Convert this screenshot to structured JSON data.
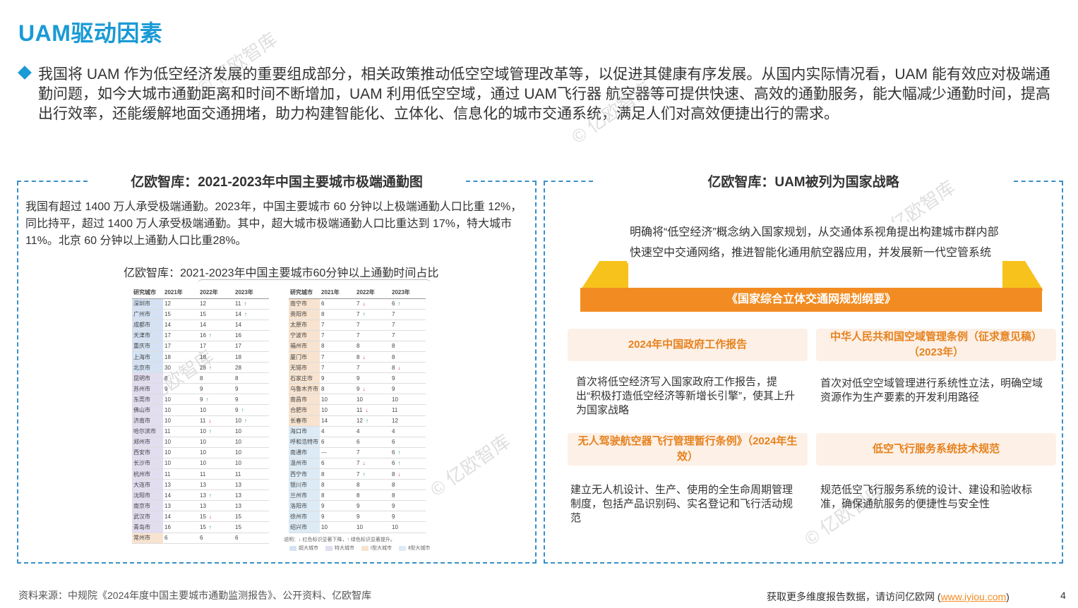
{
  "page": {
    "title": "UAM驱动因素",
    "intro": "我国将 UAM 作为低空经济发展的重要组成部分，相关政策推动低空空域管理改革等，以促进其健康有序发展。从国内实际情况看，UAM 能有效应对极端通勤问题，如今大城市通勤距离和时间不断增加，UAM 利用低空空域，通过 UAM飞行器 航空器等可提供快速、高效的通勤服务，能大幅减少通勤时间，提高出行效率，还能缓解地面交通拥堵，助力构建智能化、立体化、信息化的城市交通系统，满足人们对高效便捷出行的需求。",
    "watermark": "© 亿欧智库",
    "page_number": "4"
  },
  "left_panel": {
    "heading": "亿欧智库：2021-2023年中国主要城市极端通勤图",
    "paragraph": "我国有超过 1400 万人承受极端通勤。2023年，中国主要城市 60 分钟以上极端通勤人口比重 12%，同比持平，超过 1400 万人承受极端通勤。其中，超大城市极端通勤人口比重达到 17%，特大城市 11%。北京 60 分钟以上通勤人口比重28%。",
    "table_title": "亿欧智库：2021-2023年中国主要城市60分钟以上通勤时间占比",
    "legend_note": "说明：↓ 红色标识显著下降，↑ 绿色标识显著提升。",
    "legend_types": [
      "超大城市",
      "特大城市",
      "Ⅰ型大城市",
      "Ⅱ型大城市"
    ]
  },
  "chart_data": {
    "type": "table",
    "columns": [
      "研究城市",
      "2021年",
      "2022年",
      "2023年"
    ],
    "tables": [
      {
        "rows": [
          {
            "city": "深圳市",
            "tier": "super",
            "v2021": "12",
            "v2022": "12",
            "v2023": "11",
            "t2023": "up"
          },
          {
            "city": "广州市",
            "tier": "super",
            "v2021": "15",
            "v2022": "15",
            "v2023": "14",
            "t2023": "up"
          },
          {
            "city": "成都市",
            "tier": "super",
            "v2021": "14",
            "v2022": "14",
            "v2023": "14"
          },
          {
            "city": "天津市",
            "tier": "super",
            "v2021": "17",
            "v2022": "16",
            "t2022": "up",
            "v2023": "16"
          },
          {
            "city": "重庆市",
            "tier": "super",
            "v2021": "17",
            "v2022": "17",
            "v2023": "17"
          },
          {
            "city": "上海市",
            "tier": "super",
            "v2021": "18",
            "v2022": "18",
            "v2023": "18"
          },
          {
            "city": "北京市",
            "tier": "super",
            "v2021": "30",
            "v2022": "28",
            "t2022": "up",
            "v2023": "28"
          },
          {
            "city": "昆明市",
            "tier": "extra",
            "v2021": "8",
            "v2022": "8",
            "v2023": "8"
          },
          {
            "city": "苏州市",
            "tier": "extra",
            "v2021": "9",
            "v2022": "9",
            "v2023": "9"
          },
          {
            "city": "东莞市",
            "tier": "extra",
            "v2021": "10",
            "v2022": "9",
            "t2022": "up",
            "v2023": "9"
          },
          {
            "city": "佛山市",
            "tier": "extra",
            "v2021": "10",
            "v2022": "10",
            "v2023": "9",
            "t2023": "up"
          },
          {
            "city": "济南市",
            "tier": "extra",
            "v2021": "10",
            "v2022": "11",
            "t2022": "down",
            "v2023": "10",
            "t2023": "up"
          },
          {
            "city": "哈尔滨市",
            "tier": "extra",
            "v2021": "11",
            "v2022": "10",
            "t2022": "up",
            "v2023": "10"
          },
          {
            "city": "郑州市",
            "tier": "extra",
            "v2021": "10",
            "v2022": "10",
            "v2023": "10"
          },
          {
            "city": "西安市",
            "tier": "extra",
            "v2021": "10",
            "v2022": "10",
            "v2023": "10"
          },
          {
            "city": "长沙市",
            "tier": "extra",
            "v2021": "10",
            "v2022": "10",
            "v2023": "10"
          },
          {
            "city": "杭州市",
            "tier": "extra",
            "v2021": "11",
            "v2022": "11",
            "v2023": "11"
          },
          {
            "city": "大连市",
            "tier": "extra",
            "v2021": "13",
            "v2022": "13",
            "v2023": "13"
          },
          {
            "city": "沈阳市",
            "tier": "extra",
            "v2021": "14",
            "v2022": "13",
            "t2022": "up",
            "v2023": "13"
          },
          {
            "city": "南京市",
            "tier": "extra",
            "v2021": "13",
            "v2022": "13",
            "v2023": "13"
          },
          {
            "city": "武汉市",
            "tier": "extra",
            "v2021": "14",
            "v2022": "15",
            "t2022": "down",
            "v2023": "15"
          },
          {
            "city": "青岛市",
            "tier": "extra",
            "v2021": "16",
            "v2022": "15",
            "t2022": "up",
            "v2023": "15"
          },
          {
            "city": "常州市",
            "tier": "i",
            "v2021": "6",
            "v2022": "6",
            "v2023": "6"
          }
        ]
      },
      {
        "rows": [
          {
            "city": "南宁市",
            "tier": "i",
            "v2021": "6",
            "v2022": "7",
            "t2022": "down",
            "v2023": "6",
            "t2023": "up"
          },
          {
            "city": "贵阳市",
            "tier": "i",
            "v2021": "8",
            "v2022": "7",
            "t2022": "up",
            "v2023": "7"
          },
          {
            "city": "太原市",
            "tier": "i",
            "v2021": "7",
            "v2022": "7",
            "v2023": "7"
          },
          {
            "city": "宁波市",
            "tier": "i",
            "v2021": "7",
            "v2022": "7",
            "v2023": "7"
          },
          {
            "city": "福州市",
            "tier": "i",
            "v2021": "8",
            "v2022": "8",
            "v2023": "8"
          },
          {
            "city": "厦门市",
            "tier": "i",
            "v2021": "7",
            "v2022": "8",
            "t2022": "down",
            "v2023": "8"
          },
          {
            "city": "无锡市",
            "tier": "i",
            "v2021": "7",
            "v2022": "7",
            "v2023": "8",
            "t2023": "down"
          },
          {
            "city": "石家庄市",
            "tier": "i",
            "v2021": "9",
            "v2022": "9",
            "v2023": "9"
          },
          {
            "city": "乌鲁木齐市",
            "tier": "i",
            "v2021": "8",
            "v2022": "9",
            "t2022": "down",
            "v2023": "9"
          },
          {
            "city": "南昌市",
            "tier": "i",
            "v2021": "10",
            "v2022": "10",
            "v2023": "10"
          },
          {
            "city": "合肥市",
            "tier": "i",
            "v2021": "10",
            "v2022": "11",
            "t2022": "down",
            "v2023": "11"
          },
          {
            "city": "长春市",
            "tier": "i",
            "v2021": "14",
            "v2022": "12",
            "t2022": "up",
            "v2023": "12"
          },
          {
            "city": "海口市",
            "tier": "ii",
            "v2021": "4",
            "v2022": "4",
            "v2023": "4"
          },
          {
            "city": "呼和浩特市",
            "tier": "ii",
            "v2021": "6",
            "v2022": "6",
            "v2023": "6"
          },
          {
            "city": "南通市",
            "tier": "ii",
            "v2021": "---",
            "v2022": "7",
            "v2023": "6",
            "t2023": "up"
          },
          {
            "city": "温州市",
            "tier": "ii",
            "v2021": "6",
            "v2022": "7",
            "t2022": "down",
            "v2023": "6",
            "t2023": "up"
          },
          {
            "city": "西宁市",
            "tier": "ii",
            "v2021": "8",
            "v2022": "7",
            "t2022": "up",
            "v2023": "8",
            "t2023": "down"
          },
          {
            "city": "银川市",
            "tier": "ii",
            "v2021": "8",
            "v2022": "8",
            "v2023": "8"
          },
          {
            "city": "兰州市",
            "tier": "ii",
            "v2021": "8",
            "v2022": "8",
            "v2023": "8"
          },
          {
            "city": "洛阳市",
            "tier": "ii",
            "v2021": "9",
            "v2022": "9",
            "v2023": "9"
          },
          {
            "city": "徐州市",
            "tier": "ii",
            "v2021": "9",
            "v2022": "9",
            "v2023": "9"
          },
          {
            "city": "绍兴市",
            "tier": "ii",
            "v2021": "10",
            "v2022": "10",
            "v2023": "10"
          }
        ]
      }
    ]
  },
  "right_panel": {
    "heading": "亿欧智库：UAM被列为国家战略",
    "top_text": "明确将“低空经济”概念纳入国家规划，从交通体系视角提出构建城市群内部快速空中交通网络，推进智能化通用航空器应用，并发展新一代空管系统",
    "platform_label": "《国家综合立体交通网规划纲要》",
    "cards": [
      {
        "title": "2024年中国政府工作报告",
        "text": "首次将低空经济写入国家政府工作报告，提出“积极打造低空经济等新增长引擎”，使其上升为国家战略"
      },
      {
        "title": "中华人民共和国空域管理条例（征求意见稿）（2023年）",
        "text": "首次对低空空域管理进行系统性立法，明确空域资源作为生产要素的开发利用路径"
      },
      {
        "title": "无人驾驶航空器飞行管理暂行条例》（2024年生效）",
        "text": "建立无人机设计、生产、使用的全生命周期管理制度，包括产品识别码、实名登记和飞行活动规范"
      },
      {
        "title": "低空飞行服务系统技术规范",
        "text": "规范低空飞行服务系统的设计、建设和验收标准，确保通航服务的便捷性与安全性"
      }
    ]
  },
  "footer": {
    "source": "资料来源：中规院《2024年度中国主要城市通勤监测报告》、公开资料、亿欧智库",
    "cta_prefix": "获取更多维度报告数据，请访问亿欧网 (",
    "cta_link": "www.iyiou.com",
    "cta_suffix": ")"
  },
  "colors": {
    "accent": "#1a9ad6",
    "orange": "#f28c22",
    "yellow": "#f7c21b",
    "up": "#2a9d5a",
    "down": "#d63a2f"
  }
}
